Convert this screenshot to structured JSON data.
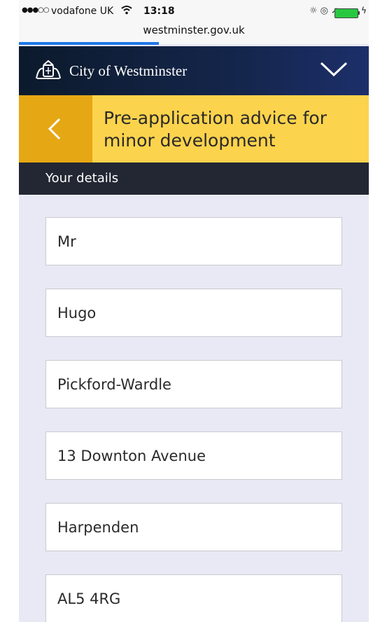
{
  "status_bar": {
    "signal": "●●●○○",
    "carrier": "vodafone UK",
    "time": "13:18",
    "url": "westminster.gov.uk",
    "page_load_progress": 0.4,
    "battery_level": 1.0,
    "battery_color": "#27c840"
  },
  "site_header": {
    "name": "City of Westminster",
    "menu_icon": "chevron-down-icon",
    "background": "#15264d"
  },
  "title_bar": {
    "title": "Pre-application advice for minor development",
    "back_icon": "chevron-left-icon",
    "background": "#fcd34c",
    "back_background": "#e6a714"
  },
  "section": {
    "label": "Your details"
  },
  "form": {
    "fields": [
      {
        "value": "Mr"
      },
      {
        "value": "Hugo"
      },
      {
        "value": "Pickford-Wardle"
      },
      {
        "value": "13 Downton Avenue"
      },
      {
        "value": "Harpenden"
      },
      {
        "value": "AL5 4RG"
      }
    ]
  }
}
